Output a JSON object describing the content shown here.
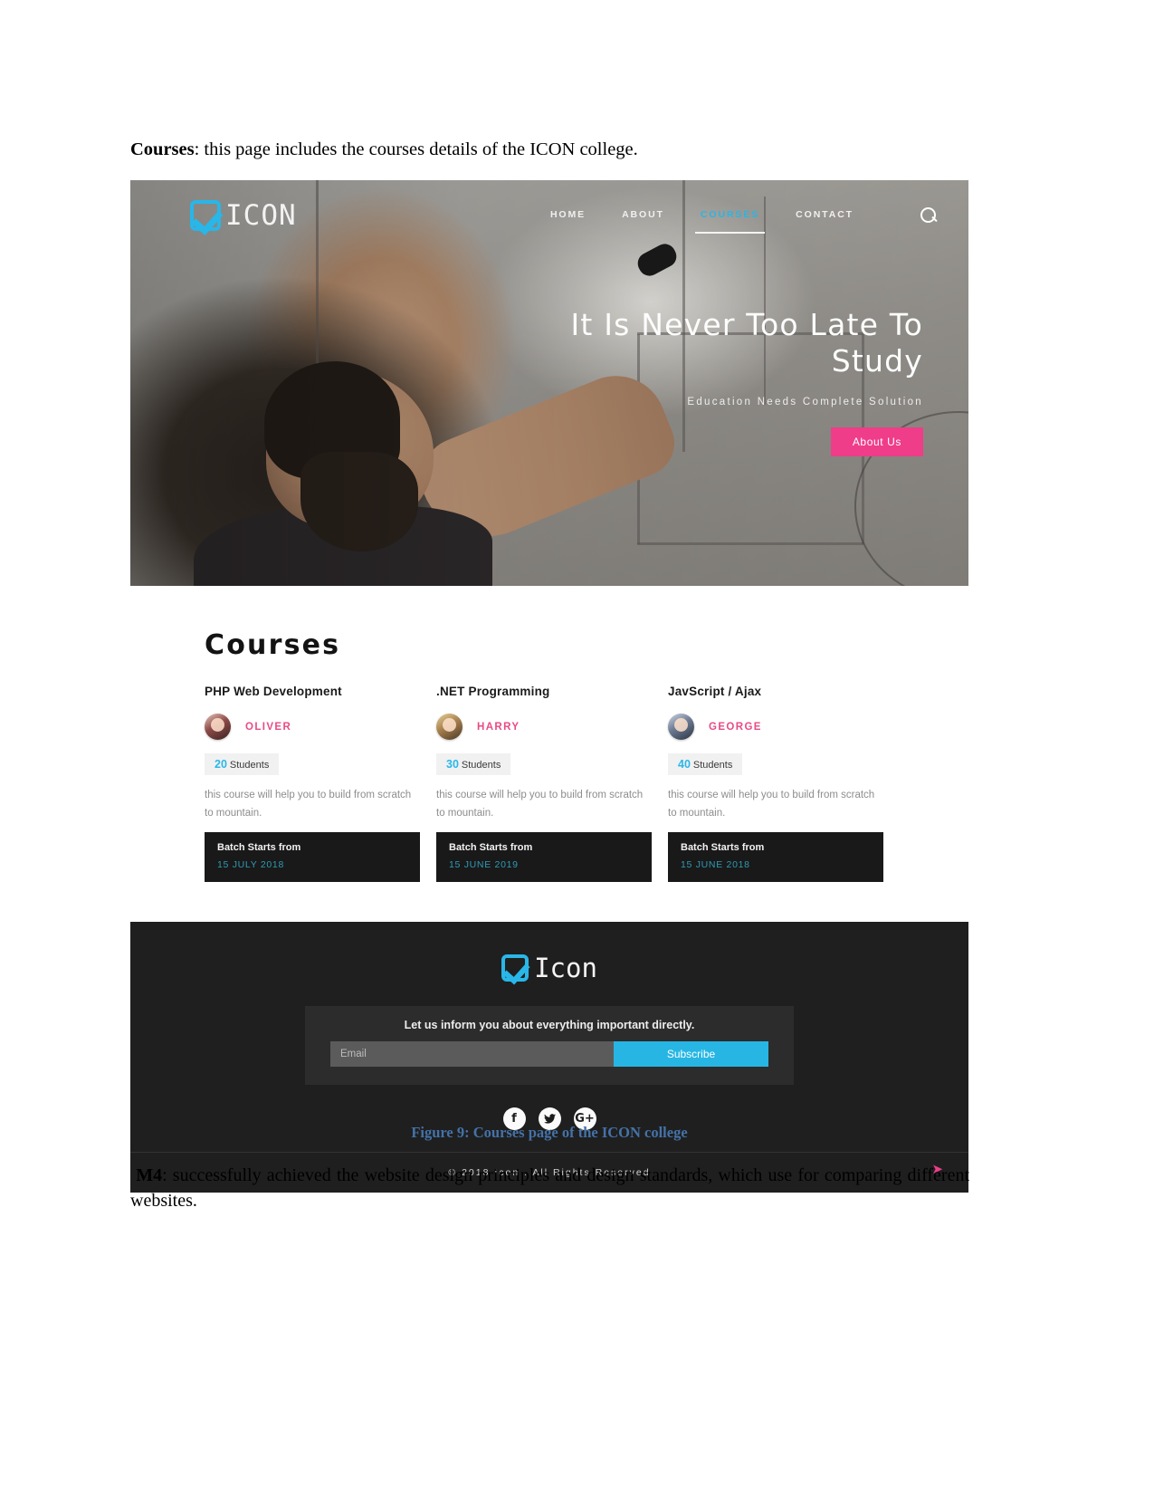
{
  "document": {
    "intro_bold": "Courses",
    "intro_rest": ":  this page includes the courses details of the ICON college.",
    "figure_caption": "Figure 9: Courses   page of the ICON college",
    "trailing_bold": "M4",
    "trailing_rest": ": successfully achieved the website design principles and design standards, which use for comparing different websites."
  },
  "site": {
    "header": {
      "logo_text": "ICON",
      "logo_icon": "checkbox-check-icon",
      "nav": [
        {
          "label": "HOME",
          "active": false
        },
        {
          "label": "ABOUT",
          "active": false
        },
        {
          "label": "COURSES",
          "active": true
        },
        {
          "label": "CONTACT",
          "active": false
        }
      ],
      "search_icon": "search-icon"
    },
    "hero": {
      "title": "It Is Never Too Late To Study",
      "subtitle": "Education Needs Complete Solution",
      "button_label": "About Us",
      "button_color": "#ef3d8a"
    },
    "courses": {
      "heading": "Courses",
      "cards": [
        {
          "title": "PHP Web Development",
          "tutor": "OLIVER",
          "students_count": "20",
          "students_label": "Students",
          "description": "this course will help you to build from scratch to mountain.",
          "batch_label": "Batch Starts from",
          "batch_date": "15 JULY 2018"
        },
        {
          "title": ".NET Programming",
          "tutor": "HARRY",
          "students_count": "30",
          "students_label": "Students",
          "description": "this course will help you to build from scratch to mountain.",
          "batch_label": "Batch Starts from",
          "batch_date": "15 JUNE 2019"
        },
        {
          "title": "JavScript / Ajax",
          "tutor": "GEORGE",
          "students_count": "40",
          "students_label": "Students",
          "description": "this course will help you to build from scratch to mountain.",
          "batch_label": "Batch Starts from",
          "batch_date": "15 JUNE 2018"
        }
      ]
    },
    "footer": {
      "logo_text": "Icon",
      "newsletter_text": "Let us inform you about everything important directly.",
      "email_placeholder": "Email",
      "subscribe_label": "Subscribe",
      "socials": [
        {
          "name": "facebook",
          "glyph": "f"
        },
        {
          "name": "twitter",
          "glyph": "ᵗ"
        },
        {
          "name": "google-plus",
          "glyph": "G+"
        }
      ],
      "copyright": "© 2018 Icon . All Rights Reserved",
      "back_to_top_icon": "arrow-up-icon"
    },
    "colors": {
      "accent_cyan": "#29b6e8",
      "accent_pink": "#ef3d8a",
      "footer_bg": "#1f1f1f",
      "caption_blue": "#4472a8"
    }
  }
}
